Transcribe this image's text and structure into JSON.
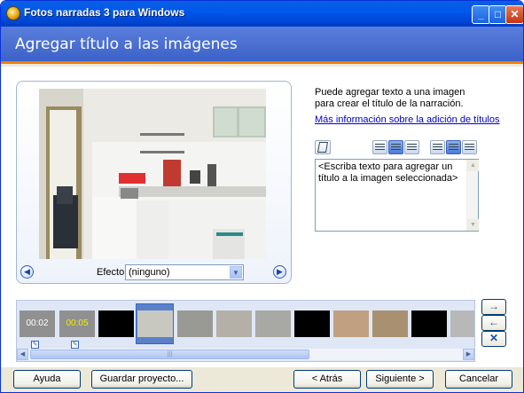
{
  "window": {
    "title": "Fotos narradas 3 para Windows"
  },
  "header": {
    "title": "Agregar título a las imágenes"
  },
  "preview": {
    "effect_label": "Efecto:",
    "effect_value": "(ninguno)"
  },
  "info": {
    "description": "Puede agregar texto a una imagen para crear el título de la narración.",
    "link": "Más información sobre la adición de títulos"
  },
  "title_text": {
    "placeholder": "<Escriba texto para agregar un título a la imagen seleccionada>"
  },
  "filmstrip": {
    "items": [
      {
        "kind": "duration",
        "label": "00:02"
      },
      {
        "kind": "duration-title",
        "label": "00:05"
      },
      {
        "kind": "black"
      },
      {
        "kind": "selected"
      },
      {
        "kind": "photo"
      },
      {
        "kind": "photo"
      },
      {
        "kind": "photo"
      },
      {
        "kind": "black"
      },
      {
        "kind": "photo"
      },
      {
        "kind": "photo"
      },
      {
        "kind": "black"
      },
      {
        "kind": "photo"
      }
    ]
  },
  "footer": {
    "help": "Ayuda",
    "save": "Guardar proyecto...",
    "back": "< Atrás",
    "next": "Siguiente >",
    "cancel": "Cancelar"
  },
  "colors": {
    "header_bg": "#3d62c8",
    "accent_line": "#f08000",
    "titlebar": "#0058ee"
  }
}
